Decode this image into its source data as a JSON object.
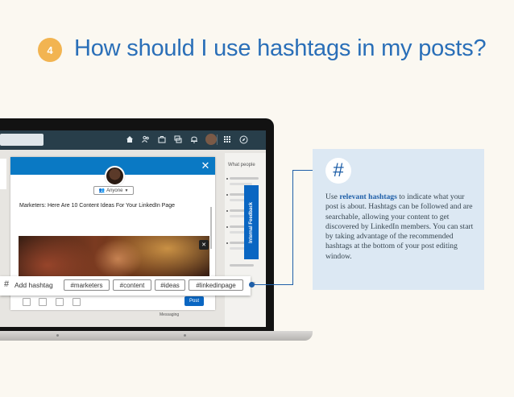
{
  "step": {
    "number": "4"
  },
  "heading": "How should I use hashtags in my posts?",
  "modal": {
    "audience": "Anyone",
    "post_text": "Marketers: Here Are 10 Content Ideas For Your LinkedIn Page",
    "post_button": "Post"
  },
  "sidebar": {
    "title": "What people",
    "feedback_tab": "Internal Feedback",
    "messaging": "Messaging"
  },
  "hashtag_bar": {
    "add_label": "Add hashtag",
    "tags": [
      "#marketers",
      "#content",
      "#ideas",
      "#linkedinpage"
    ]
  },
  "info": {
    "before": "Use ",
    "highlight": "relevant hashtags",
    "after": " to indicate what your post is about. Hashtags can be followed and are searchable, allowing your content to get discovered by LinkedIn members. You can start by taking advantage of the recommended hashtags at the bottom of your post editing window."
  },
  "colors": {
    "accent": "#2a6fb8",
    "badge": "#f2b451",
    "linkedin_blue": "#0a66c2",
    "card_bg": "#dce8f3"
  }
}
